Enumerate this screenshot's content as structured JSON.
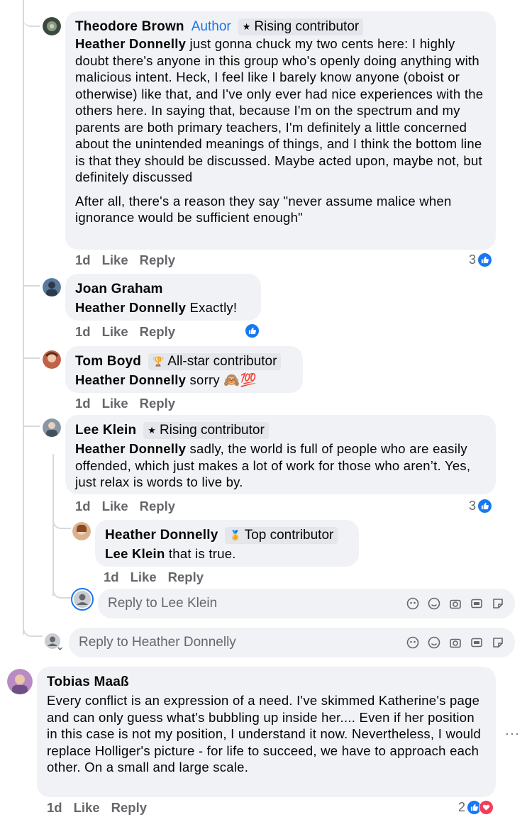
{
  "comments": [
    {
      "name": "Theodore Brown",
      "author_label": "Author",
      "badge": "Rising contributor",
      "mention": "Heather Donnelly",
      "text": " just gonna chuck my two cents here: I highly doubt there's anyone in this group who's openly doing anything with malicious intent. Heck, I feel like I barely know anyone (oboist or otherwise) like that, and I've only ever had nice experiences with the others here. In saying that, because I'm on the spectrum and my parents are both primary teachers, I'm definitely a little concerned about the unintended meanings of things, and I think the bottom line is that they should be discussed. Maybe acted upon, maybe not, but definitely discussed",
      "text2": "After all, there's a reason they say \"never assume malice when ignorance would be sufficient enough\"",
      "time": "1d",
      "like": "Like",
      "reply": "Reply",
      "reactions": "3"
    },
    {
      "name": "Joan Graham",
      "mention": "Heather Donnelly",
      "text": " Exactly!",
      "time": "1d",
      "like": "Like",
      "reply": "Reply"
    },
    {
      "name": "Tom Boyd",
      "badge": "All-star contributor",
      "mention": "Heather Donnelly",
      "text": " sorry 🙈💯",
      "time": "1d",
      "like": "Like",
      "reply": "Reply"
    },
    {
      "name": "Lee Klein",
      "badge": "Rising contributor",
      "mention": "Heather Donnelly",
      "text": " sadly, the world is full of people who are easily offended, which just makes a lot of work for those who aren’t. Yes, just relax is words to live by.",
      "time": "1d",
      "like": "Like",
      "reply": "Reply",
      "reactions": "3"
    },
    {
      "name": "Heather Donnelly",
      "badge": "Top contributor",
      "mention": "Lee Klein",
      "text": " that is true.",
      "time": "1d",
      "like": "Like",
      "reply": "Reply"
    },
    {
      "name": "Tobias Maaß",
      "text": "Every conflict is an expression of a need. I've skimmed Katherine's page and can only guess what's bubbling up inside her.... Even if her position in this case is not my position, I understand it now. Nevertheless, I would replace Holliger's picture - for life to succeed, we have to approach each other. On a small and large scale.",
      "time": "1d",
      "like": "Like",
      "reply": "Reply",
      "reactions": "2",
      "more": "···"
    }
  ],
  "reply_boxes": [
    {
      "placeholder": "Reply to Lee Klein"
    },
    {
      "placeholder": "Reply to Heather Donnelly"
    }
  ],
  "icons": {
    "like": "thumbs-up-icon",
    "love": "heart-icon",
    "composer": [
      "avatar-sticker-icon",
      "emoji-icon",
      "camera-icon",
      "gif-icon",
      "sticker-icon"
    ]
  },
  "colors": {
    "like": "#1877f2",
    "love": "#f33e58",
    "author": "#1b74e4"
  }
}
